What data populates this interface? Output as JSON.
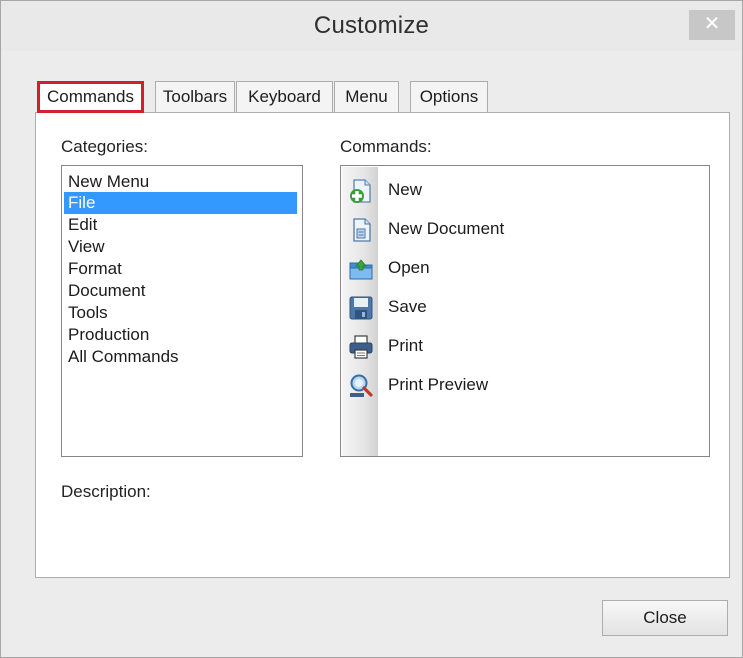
{
  "window": {
    "title": "Customize",
    "close_glyph": "✕"
  },
  "tabs": [
    {
      "label": "Commands",
      "active": true
    },
    {
      "label": "Toolbars",
      "active": false
    },
    {
      "label": "Keyboard",
      "active": false
    },
    {
      "label": "Menu",
      "active": false
    },
    {
      "label": "Options",
      "active": false
    }
  ],
  "categories": {
    "label": "Categories:",
    "selected": "File",
    "items": [
      {
        "label": "New Menu"
      },
      {
        "label": "File"
      },
      {
        "label": "Edit"
      },
      {
        "label": "View"
      },
      {
        "label": "Format"
      },
      {
        "label": "Document"
      },
      {
        "label": "Tools"
      },
      {
        "label": "Production"
      },
      {
        "label": "All Commands"
      }
    ]
  },
  "commands": {
    "label": "Commands:",
    "items": [
      {
        "label": "New",
        "icon": "new-icon"
      },
      {
        "label": "New Document",
        "icon": "new-document-icon"
      },
      {
        "label": "Open",
        "icon": "open-icon"
      },
      {
        "label": "Save",
        "icon": "save-icon"
      },
      {
        "label": "Print",
        "icon": "print-icon"
      },
      {
        "label": "Print Preview",
        "icon": "print-preview-icon"
      }
    ]
  },
  "description": {
    "label": "Description:"
  },
  "footer": {
    "close_label": "Close"
  },
  "colors": {
    "highlight": "#3399ff",
    "active_tab_outline": "#d01f2f"
  }
}
